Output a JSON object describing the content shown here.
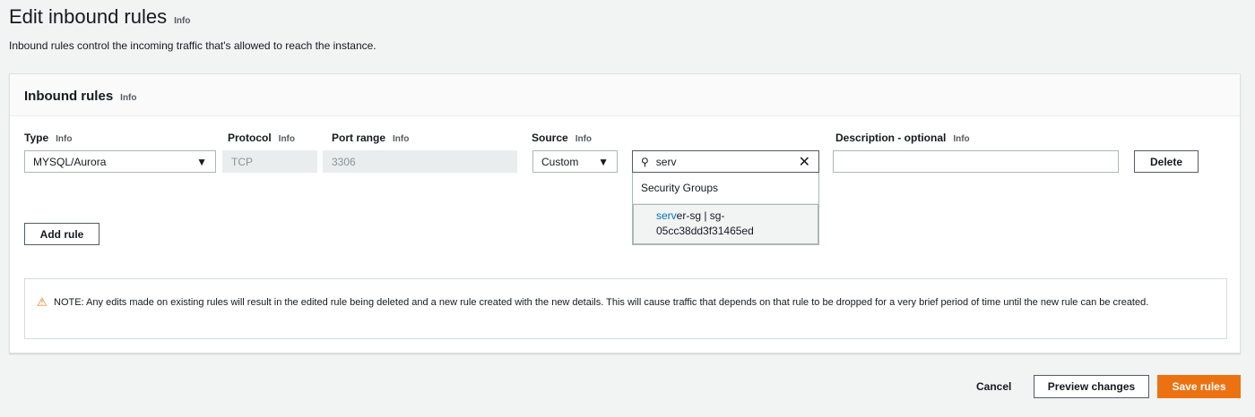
{
  "page": {
    "title": "Edit inbound rules",
    "title_info": "Info",
    "subtitle": "Inbound rules control the incoming traffic that's allowed to reach the instance."
  },
  "panel": {
    "title": "Inbound rules",
    "info": "Info"
  },
  "columns": {
    "type": "Type",
    "protocol": "Protocol",
    "port_range": "Port range",
    "source": "Source",
    "description": "Description - optional",
    "info": "Info"
  },
  "rule": {
    "type": "MYSQL/Aurora",
    "protocol": "TCP",
    "port_range": "3306",
    "source": "Custom",
    "search": "serv",
    "description": "",
    "delete": "Delete"
  },
  "dropdown": {
    "group": "Security Groups",
    "match": "serv",
    "option_rest": "er-sg | sg-",
    "option_line2": "05cc38dd3f31465ed"
  },
  "add_rule": "Add rule",
  "note": "NOTE: Any edits made on existing rules will result in the edited rule being deleted and a new rule created with the new details. This will cause traffic that depends on that rule to be dropped for a very brief period of time until the new rule can be created.",
  "footer": {
    "cancel": "Cancel",
    "preview": "Preview changes",
    "save": "Save rules"
  },
  "colors": {
    "primary": "#ec7211",
    "warning": "#d13212"
  }
}
